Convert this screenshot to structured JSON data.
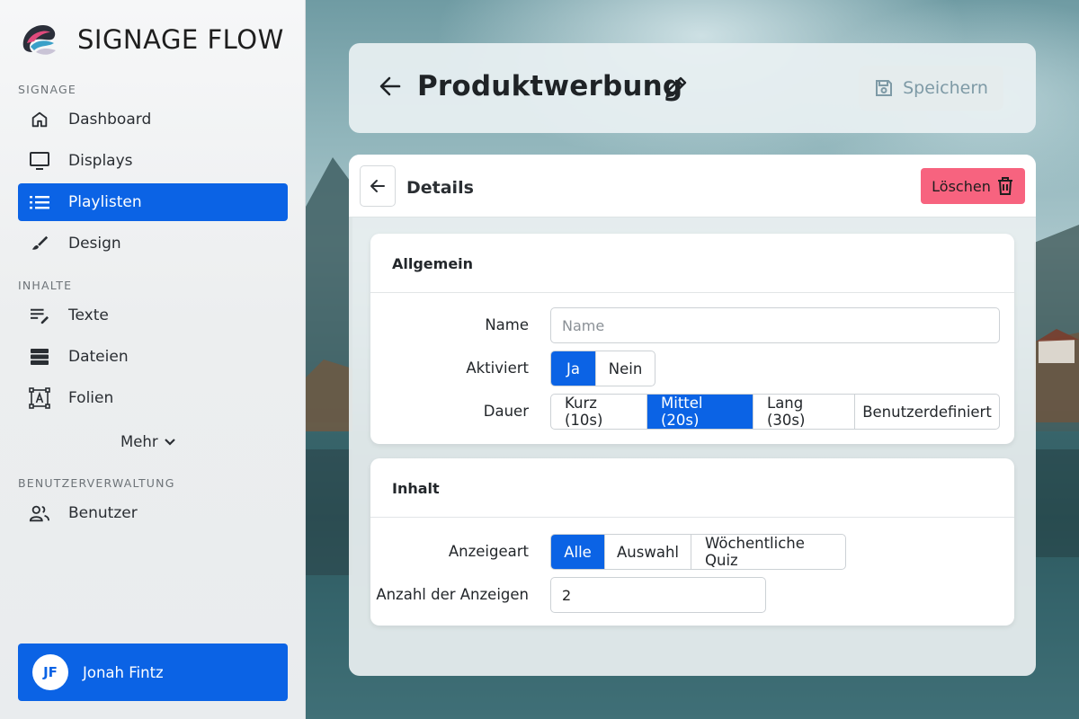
{
  "app": {
    "brand_name": "SIGNAGE FLOW"
  },
  "sidebar": {
    "sections": [
      {
        "label": "SIGNAGE"
      },
      {
        "label": "INHALTE"
      },
      {
        "label": "BENUTZERVERWALTUNG"
      }
    ],
    "items": [
      {
        "label": "Dashboard",
        "icon": "home-icon"
      },
      {
        "label": "Displays",
        "icon": "monitor-icon"
      },
      {
        "label": "Playlisten",
        "icon": "list-icon",
        "active": true
      },
      {
        "label": "Design",
        "icon": "brush-icon"
      },
      {
        "label": "Texte",
        "icon": "text-edit-icon"
      },
      {
        "label": "Dateien",
        "icon": "storage-icon"
      },
      {
        "label": "Folien",
        "icon": "slide-frame-icon"
      },
      {
        "label": "Benutzer",
        "icon": "users-icon"
      }
    ],
    "more_label": "Mehr",
    "user": {
      "initials": "JF",
      "name": "Jonah Fintz"
    }
  },
  "header": {
    "title": "Produktwerbung",
    "save_label": "Speichern"
  },
  "details": {
    "title": "Details",
    "delete_label": "Löschen"
  },
  "general": {
    "title": "Allgemein",
    "name_label": "Name",
    "name_value": "",
    "name_placeholder": "Name",
    "active_label": "Aktiviert",
    "active_options": [
      "Ja",
      "Nein"
    ],
    "active_selected": "Ja",
    "duration_label": "Dauer",
    "duration_options": [
      "Kurz (10s)",
      "Mittel (20s)",
      "Lang (30s)",
      "Benutzerdefiniert"
    ],
    "duration_selected": "Mittel (20s)"
  },
  "content": {
    "title": "Inhalt",
    "display_type_label": "Anzeigeart",
    "display_type_options": [
      "Alle",
      "Auswahl",
      "Wöchentliche Quiz"
    ],
    "display_type_selected": "Alle",
    "count_label": "Anzahl der Anzeigen",
    "count_value": "2"
  },
  "colors": {
    "accent": "#0b63e5",
    "danger": "#f7637f"
  }
}
